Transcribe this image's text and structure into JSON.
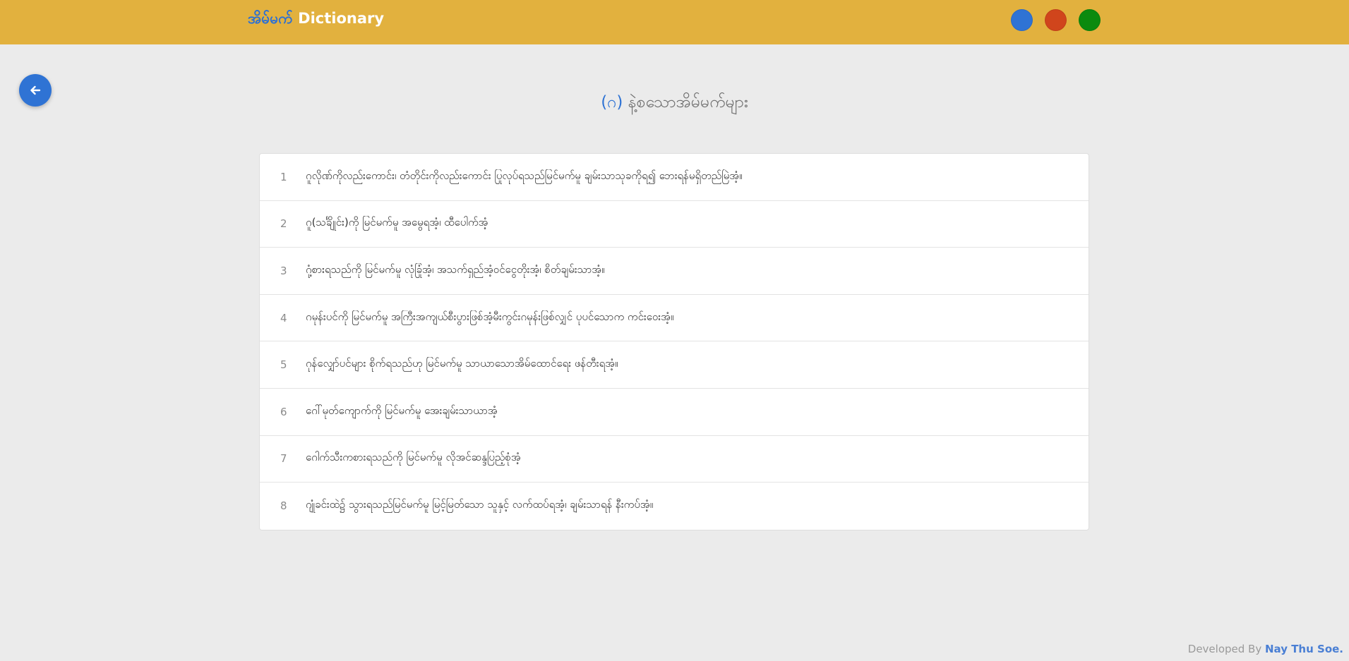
{
  "navbar": {
    "brand_mm": "အိမ်မက်",
    "brand_en": " Dictionary",
    "theme_colors": [
      "#2f73d4",
      "#d0451c",
      "#0b8a0e"
    ],
    "theme_names": [
      "blue-theme-button",
      "orange-theme-button",
      "green-theme-button"
    ]
  },
  "back_button": {
    "icon": "arrow-left-icon"
  },
  "page": {
    "title_num": "(ဂ)",
    "title_text": " နဲ့စသောအိမ်မက်များ"
  },
  "items": [
    {
      "num": "1",
      "text": "ဂူလိုဏ်ကိုလည်းကောင်း၊ တံတိုင်းကိုလည်းကောင်း ပြုလုပ်ရသည်မြင်မက်မူ ချမ်းသာသုခကိုရ၍ ဘေးရန်မရှိတည်မြဲအံ့။"
    },
    {
      "num": "2",
      "text": "ဂူ(သင်္ချိုင်း)ကို မြင်မက်မူ အမွေရအံ့၊ ထီပေါက်အံ့"
    },
    {
      "num": "3",
      "text": "ဂုံ့စားရသည်ကို မြင်မက်မူ လုံခြုံအံ့၊ အသက်ရှည်အံ့ဝင်ငွေတိုးအံ့၊ စိတ်ချမ်းသာအံ့။"
    },
    {
      "num": "4",
      "text": "ဂမုန်းပင်ကို မြင်မက်မူ အကြီးအကျယ်စီးပွားဖြစ်အံ့မီးကွင်းဂမုန်းဖြစ်လျှင် ပုပင်သောက ကင်းဝေးအံ့။"
    },
    {
      "num": "5",
      "text": "ဂုန်လျှော်ပင်များ စိုက်ရသည်ဟု မြင်မက်မူ သာယာသောအိမ်ထောင်ရေး ဖန်တီးရအံ့။"
    },
    {
      "num": "6",
      "text": "ဂေါ်မုတ်ကျောက်ကို မြင်မက်မူ အေးချမ်းသာယာအံ့"
    },
    {
      "num": "7",
      "text": "ဂေါက်သီးကစားရသည်ကို မြင်မက်မူ လိုအင်ဆန္ဒပြည့်စုံအံ့"
    },
    {
      "num": "8",
      "text": "ဂျုံခင်းထဲ၌ သွားရသည်မြင်မက်မူ မြင့်မြတ်သော သူနှင့် လက်ထပ်ရအံ့၊ ချမ်းသာရန် နီးကပ်အံ့။"
    }
  ],
  "footer": {
    "prefix": "Developed By ",
    "name": "Nay Thu Soe."
  }
}
